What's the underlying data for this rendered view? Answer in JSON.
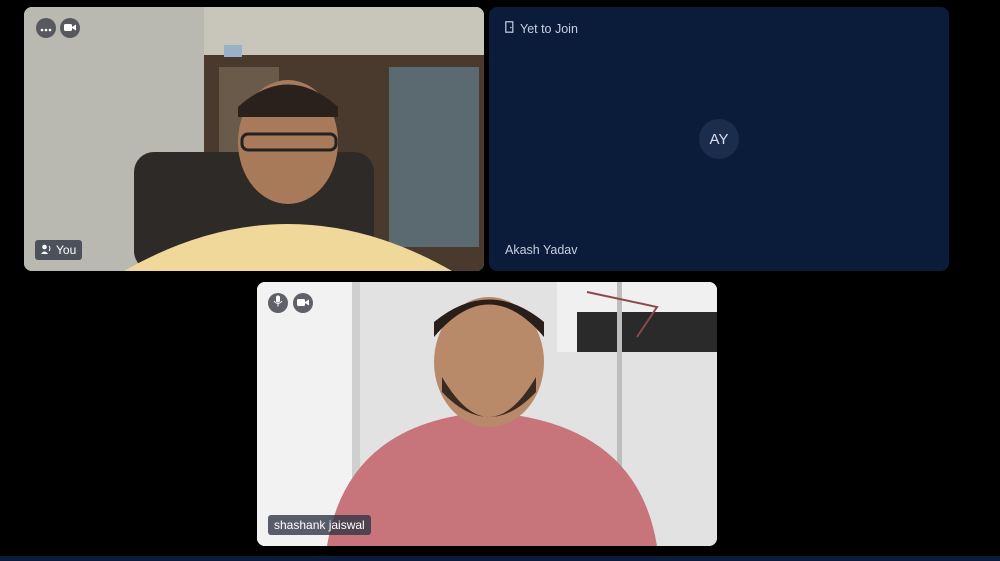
{
  "tiles": {
    "you": {
      "label": "You",
      "icons": [
        "more-icon",
        "camera-icon",
        "speaker-icon"
      ]
    },
    "akash": {
      "status": "Yet to Join",
      "initials": "AY",
      "name": "Akash Yadav",
      "icons": [
        "door-icon"
      ]
    },
    "shashank": {
      "label": "shashank jaiswal",
      "icons": [
        "mic-icon",
        "camera-icon"
      ]
    }
  },
  "colors": {
    "background": "#000000",
    "tile_dark": "#0b1b3a",
    "avatar_bg": "#1c2c4c"
  }
}
